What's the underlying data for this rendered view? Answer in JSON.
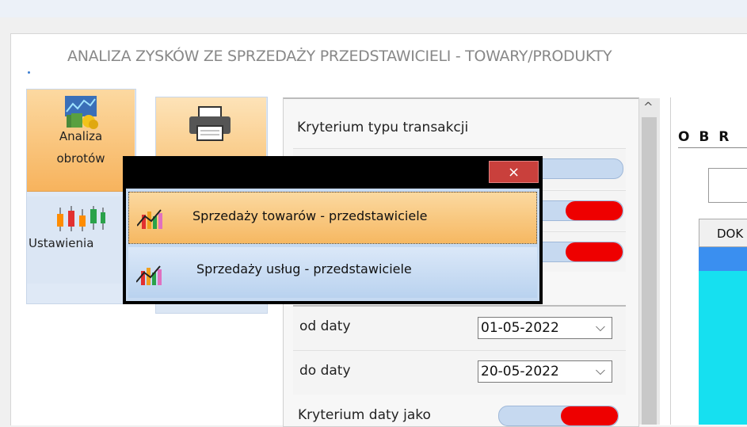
{
  "window": {
    "title": "ANALIZA ZYSKÓW ZE SPRZEDAŻY PRZEDSTAWICIELI - TOWARY/PRODUKTY"
  },
  "tiles": {
    "analiza_line1": "Analiza",
    "analiza_line2": "obrotów",
    "ustawienia": "Ustawienia"
  },
  "filters": {
    "transaction_type_label": "Kryterium typu transakcji",
    "from_label": "od daty",
    "from_value": "01-05-2022",
    "to_label": "do daty",
    "to_value": "20-05-2022",
    "date_criteria_label": "Kryterium daty jako"
  },
  "right_pane": {
    "heading": "O B R",
    "column_header": "DOK"
  },
  "popup": {
    "close_glyph": "×",
    "items": [
      {
        "label": "Sprzedaży towarów - przedstawiciele"
      },
      {
        "label": "Sprzedaży usług - przedstawiciele"
      }
    ]
  },
  "colors": {
    "toggle_on": "#ee0000",
    "toggle_green": "#1e8a2a",
    "grid_fill": "#16e0f0",
    "selection": "#3a8ff0"
  },
  "icons": [
    "chart-money-icon",
    "candlestick-icon",
    "printer-icon",
    "chart-bars-icon"
  ]
}
